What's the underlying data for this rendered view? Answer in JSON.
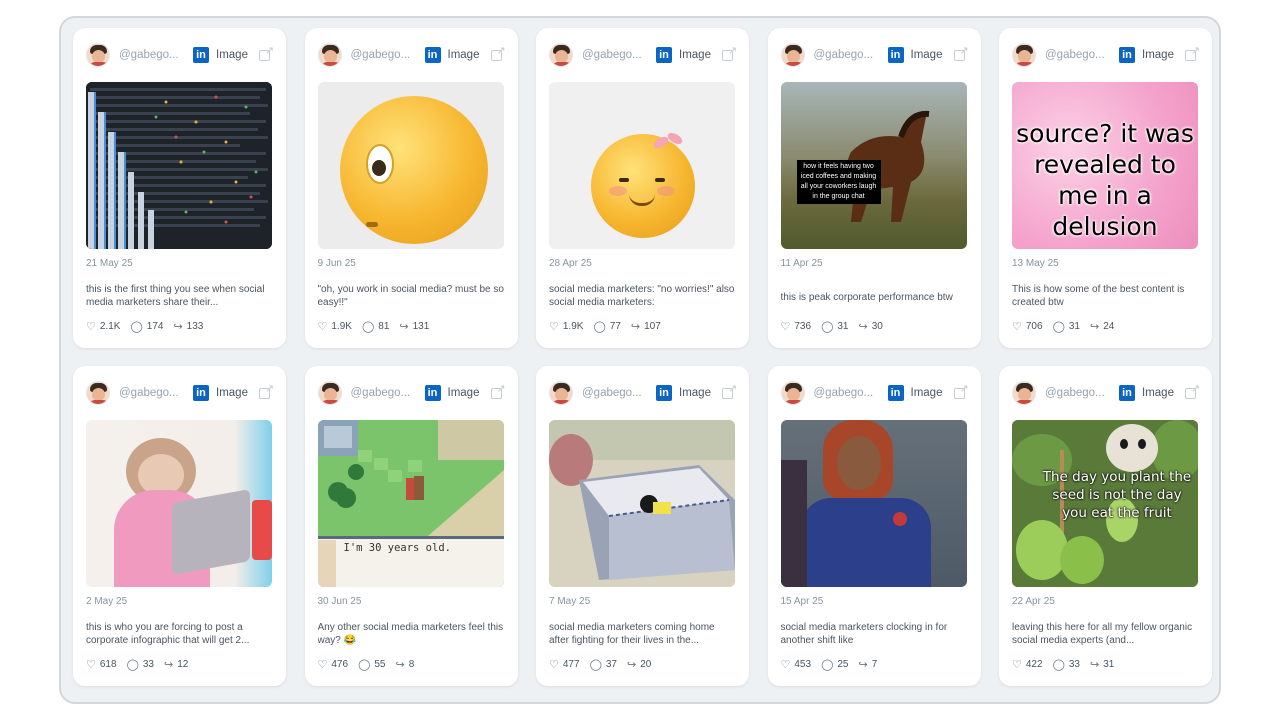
{
  "posts": [
    {
      "handle": "@gabego...",
      "type": "Image",
      "date": "21 May 25",
      "caption": "this is the first thing you see when social media marketers share their...",
      "likes": "2.1K",
      "comments": "174",
      "shares": "133"
    },
    {
      "handle": "@gabego...",
      "type": "Image",
      "date": "9 Jun 25",
      "caption": "\"oh, you work in social media? must be so easy!!\"",
      "likes": "1.9K",
      "comments": "81",
      "shares": "131"
    },
    {
      "handle": "@gabego...",
      "type": "Image",
      "date": "28 Apr 25",
      "caption": "social media marketers: \"no worries!\" also social media marketers:",
      "likes": "1.9K",
      "comments": "77",
      "shares": "107"
    },
    {
      "handle": "@gabego...",
      "type": "Image",
      "date": "11 Apr 25",
      "caption": "this is peak corporate performance btw",
      "likes": "736",
      "comments": "31",
      "shares": "30",
      "overlay": "how it feels having two iced coffees and making all your coworkers laugh in the group chat"
    },
    {
      "handle": "@gabego...",
      "type": "Image",
      "date": "13 May 25",
      "caption": "This is how some of the best content is created btw",
      "likes": "706",
      "comments": "31",
      "shares": "24",
      "overlay": "source? it was revealed to me in a delusion"
    },
    {
      "handle": "@gabego...",
      "type": "Image",
      "date": "2 May 25",
      "caption": "this is who you are forcing to post a corporate infographic that will get 2...",
      "likes": "618",
      "comments": "33",
      "shares": "12"
    },
    {
      "handle": "@gabego...",
      "type": "Image",
      "date": "30 Jun 25",
      "caption": "Any other social media marketers feel this way? 😂",
      "likes": "476",
      "comments": "55",
      "shares": "8",
      "overlay": "I'm 30 years old."
    },
    {
      "handle": "@gabego...",
      "type": "Image",
      "date": "7 May 25",
      "caption": "social media marketers coming home after fighting for their lives in the...",
      "likes": "477",
      "comments": "37",
      "shares": "20"
    },
    {
      "handle": "@gabego...",
      "type": "Image",
      "date": "15 Apr 25",
      "caption": "social media marketers clocking in for another shift like",
      "likes": "453",
      "comments": "25",
      "shares": "7"
    },
    {
      "handle": "@gabego...",
      "type": "Image",
      "date": "22 Apr 25",
      "caption": "leaving this here for all my fellow organic social media experts (and...",
      "likes": "422",
      "comments": "33",
      "shares": "31",
      "overlay": "The day you plant the seed is not the day you eat the fruit"
    }
  ],
  "icons": {
    "network": "linkedin-icon",
    "external": "external-link-icon",
    "like": "heart-icon",
    "comment": "comment-icon",
    "share": "share-icon"
  },
  "colors": {
    "linkedin": "#0a66c2",
    "frame_bg": "#eef1f4"
  }
}
